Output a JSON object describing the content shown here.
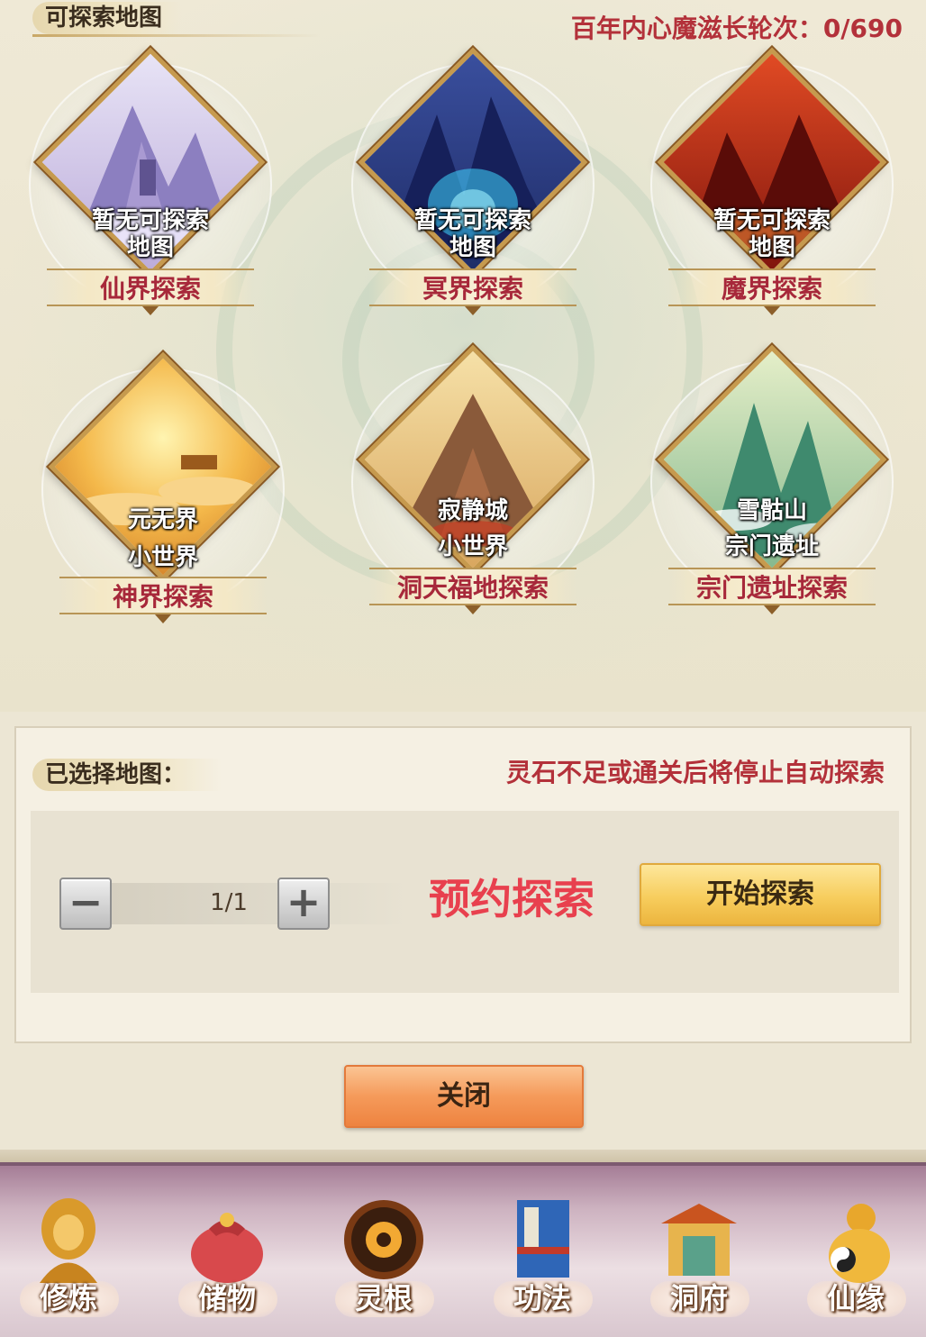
{
  "header": {
    "section_title": "可探索地图",
    "growth_label": "百年内心魔滋长轮次：0/690"
  },
  "maps": [
    {
      "line1": "暂无可探索",
      "line2": "地图",
      "title": "仙界探索",
      "theme": "immortal"
    },
    {
      "line1": "暂无可探索",
      "line2": "地图",
      "title": "冥界探索",
      "theme": "underworld"
    },
    {
      "line1": "暂无可探索",
      "line2": "地图",
      "title": "魔界探索",
      "theme": "demon"
    },
    {
      "line1": "元无界",
      "line2": "小世界",
      "title": "神界探索",
      "theme": "divine"
    },
    {
      "line1": "寂静城",
      "line2": "小世界",
      "title": "洞天福地探索",
      "theme": "paradise"
    },
    {
      "line1": "雪骷山",
      "line2": "宗门遗址",
      "title": "宗门遗址探索",
      "theme": "sect"
    }
  ],
  "selected": {
    "label": "已选择地图：",
    "warning": "灵石不足或通关后将停止自动探索",
    "stepper_value": "1/1",
    "minus": "−",
    "plus": "+",
    "reserve_label": "预约探索",
    "start_button": "开始探索"
  },
  "close_button": "关闭",
  "bottom_nav": [
    {
      "label": "修炼",
      "icon": "meditating-monk-icon"
    },
    {
      "label": "储物",
      "icon": "treasure-bag-icon"
    },
    {
      "label": "灵根",
      "icon": "spirit-root-medallion-icon"
    },
    {
      "label": "功法",
      "icon": "scripture-book-icon"
    },
    {
      "label": "洞府",
      "icon": "cave-palace-icon"
    },
    {
      "label": "仙缘",
      "icon": "gourd-taiji-icon"
    }
  ],
  "colors": {
    "accent_red": "#b3313a",
    "reserve_red": "#e8404e",
    "start_gold": "#f7cd5d",
    "close_orange": "#f59a5a"
  }
}
